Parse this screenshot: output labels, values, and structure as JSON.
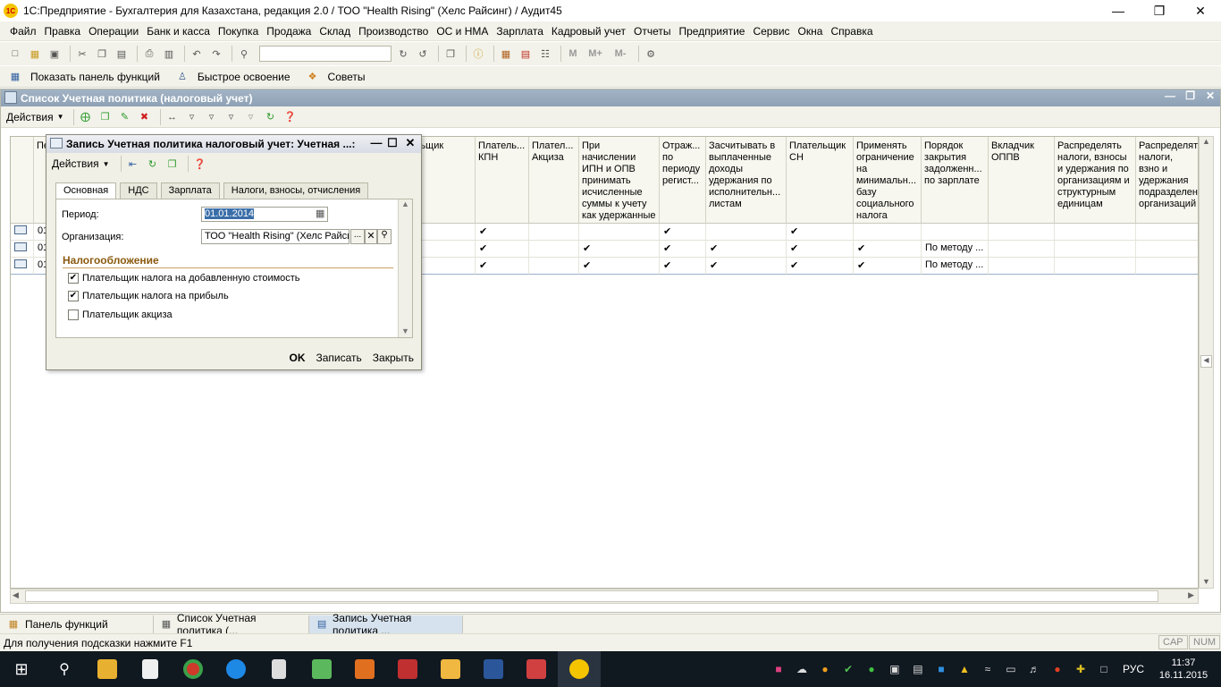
{
  "window": {
    "title": "1С:Предприятие - Бухгалтерия для Казахстана, редакция 2.0 / ТОО \"Health Rising\" (Хелс Райсинг) / Аудит45",
    "logo": "1C"
  },
  "menu": [
    "Файл",
    "Правка",
    "Операции",
    "Банк и касса",
    "Покупка",
    "Продажа",
    "Склад",
    "Производство",
    "ОС и НМА",
    "Зарплата",
    "Кадровый учет",
    "Отчеты",
    "Предприятие",
    "Сервис",
    "Окна",
    "Справка"
  ],
  "toolbar2": {
    "functions_panel": "Показать панель функций",
    "quick_learning": "Быстрое освоение",
    "tips": "Советы"
  },
  "toolbar1": {
    "m": "M",
    "mplus": "M+",
    "mminus": "M-"
  },
  "list": {
    "title": "Список Учетная политика (налоговый учет)",
    "actions_label": "Действия",
    "columns": [
      {
        "label": "Пе"
      },
      {
        "label": "льщик"
      },
      {
        "label": "Платель... КПН"
      },
      {
        "label": "Плател... Акциза"
      },
      {
        "label": "При начислении ИПН и ОПВ принимать исчисленные суммы к учету как удержанные"
      },
      {
        "label": "Отраж... по периоду регист..."
      },
      {
        "label": "Засчитывать в выплаченные доходы удержания по исполнительн... листам"
      },
      {
        "label": "Плательщик СН"
      },
      {
        "label": "Применять ограничение на минимальн... базу социального налога"
      },
      {
        "label": "Порядок закрытия задолженн... по зарплате"
      },
      {
        "label": "Вкладчик ОППВ"
      },
      {
        "label": "Распределять налоги, взносы и удержания по организациям и структурным единицам"
      },
      {
        "label": "Распределят налоги, взно и удержания подразделен организаций"
      }
    ],
    "rows": [
      {
        "period": "01",
        "kpn": "✔",
        "excise": "",
        "ipn": "",
        "reg": "✔",
        "withhold": "",
        "sn": "✔",
        "minbase": "",
        "closing": "",
        "oppv": "",
        "d1": "",
        "d2": ""
      },
      {
        "period": "01",
        "kpn": "✔",
        "excise": "",
        "ipn": "✔",
        "reg": "✔",
        "withhold": "✔",
        "sn": "✔",
        "minbase": "✔",
        "closing": "По методу ...",
        "oppv": "",
        "d1": "",
        "d2": ""
      },
      {
        "period": "01",
        "kpn": "✔",
        "excise": "",
        "ipn": "✔",
        "reg": "✔",
        "withhold": "✔",
        "sn": "✔",
        "minbase": "✔",
        "closing": "По методу ...",
        "oppv": "",
        "d1": "",
        "d2": ""
      }
    ]
  },
  "dialog": {
    "title": "Запись Учетная политика налоговый учет: Учетная ...:",
    "actions_label": "Действия",
    "tabs": [
      "Основная",
      "НДС",
      "Зарплата",
      "Налоги, взносы, отчисления"
    ],
    "period_label": "Период:",
    "period_value": "01.01.2014",
    "org_label": "Организация:",
    "org_value": "ТОО \"Health Rising\" (Хелс Райсин",
    "section_title": "Налогообложение",
    "checkboxes": [
      {
        "label": "Плательщик налога на добавленную стоимость",
        "checked": "✔"
      },
      {
        "label": "Плательщик налога на прибыль",
        "checked": "✔"
      },
      {
        "label": "Плательщик акциза",
        "checked": ""
      }
    ],
    "ok": "OK",
    "save": "Записать",
    "close": "Закрыть"
  },
  "taskstrip": [
    {
      "label": "Панель функций"
    },
    {
      "label": "Список Учетная политика (..."
    },
    {
      "label": "Запись Учетная политика ..."
    }
  ],
  "status": {
    "hint": "Для получения подсказки нажмите F1",
    "cap": "CAP",
    "num": "NUM"
  },
  "taskbar": {
    "lang": "РУС",
    "time": "11:37",
    "date": "16.11.2015"
  }
}
